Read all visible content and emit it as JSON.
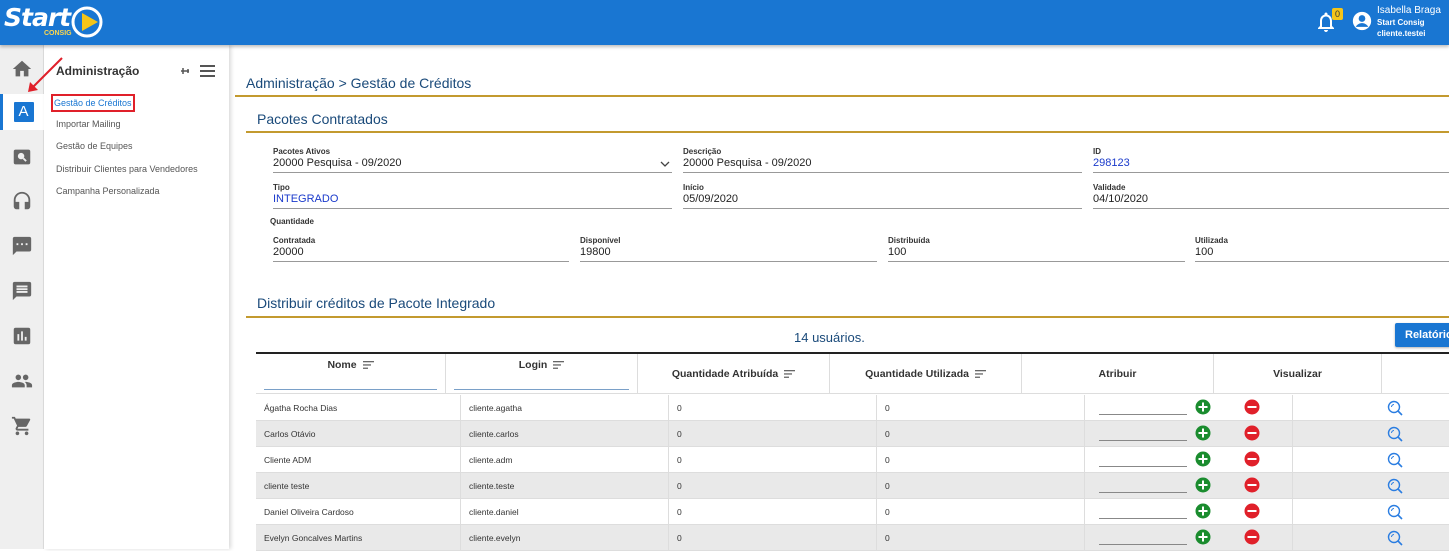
{
  "header": {
    "logo_text": "Start",
    "logo_sub": "CONSIG",
    "notifications_count": "0",
    "user_name": "Isabella Braga",
    "user_company": "Start Consig",
    "user_login": "cliente.testei"
  },
  "rail": {
    "items": [
      "home-icon",
      "admin-icon",
      "search-icon",
      "headset-icon",
      "chat-icon",
      "message-icon",
      "chart-icon",
      "people-icon",
      "cart-icon"
    ],
    "active_letter": "A"
  },
  "submenu": {
    "title": "Administração",
    "items": [
      {
        "label": "Gestão de Créditos",
        "active": true
      },
      {
        "label": "Importar Mailing"
      },
      {
        "label": "Gestão de Equipes"
      },
      {
        "label": "Distribuir Clientes para Vendedores"
      },
      {
        "label": "Campanha Personalizada"
      }
    ]
  },
  "breadcrumb": "Administração > Gestão de Créditos",
  "pacotes": {
    "title": "Pacotes Contratados",
    "pacotes_ativos_label": "Pacotes Ativos",
    "pacotes_ativos_value": "20000 Pesquisa - 09/2020",
    "descricao_label": "Descrição",
    "descricao_value": "20000 Pesquisa - 09/2020",
    "id_label": "ID",
    "id_value": "298123",
    "tipo_label": "Tipo",
    "tipo_value": "INTEGRADO",
    "inicio_label": "Início",
    "inicio_value": "05/09/2020",
    "validade_label": "Validade",
    "validade_value": "04/10/2020",
    "quantidade_label": "Quantidade",
    "contratada_label": "Contratada",
    "contratada_value": "20000",
    "disponivel_label": "Disponível",
    "disponivel_value": "19800",
    "distribuida_label": "Distribuída",
    "distribuida_value": "100",
    "utilizada_label": "Utilizada",
    "utilizada_value": "100"
  },
  "distribuir": {
    "title": "Distribuir créditos de Pacote Integrado",
    "users_count": "14 usuários.",
    "report_button": "Relatório",
    "columns": {
      "nome": "Nome",
      "login": "Login",
      "qtd_atribuida": "Quantidade Atribuída",
      "qtd_utilizada": "Quantidade Utilizada",
      "atribuir": "Atribuir",
      "visualizar": "Visualizar"
    },
    "rows": [
      {
        "nome": "Ágatha Rocha Dias",
        "login": "cliente.agatha",
        "atribuida": "0",
        "utilizada": "0"
      },
      {
        "nome": "Carlos Otávio",
        "login": "cliente.carlos",
        "atribuida": "0",
        "utilizada": "0"
      },
      {
        "nome": "Cliente ADM",
        "login": "cliente.adm",
        "atribuida": "0",
        "utilizada": "0"
      },
      {
        "nome": "cliente teste",
        "login": "cliente.teste",
        "atribuida": "0",
        "utilizada": "0"
      },
      {
        "nome": "Daniel Oliveira Cardoso",
        "login": "cliente.daniel",
        "atribuida": "0",
        "utilizada": "0"
      },
      {
        "nome": "Evelyn Goncalves Martins",
        "login": "cliente.evelyn",
        "atribuida": "0",
        "utilizada": "0"
      }
    ]
  },
  "colors": {
    "primary": "#1976d2",
    "gold": "#c39a2f",
    "plus": "#1a8c2e",
    "minus": "#e0202a"
  }
}
